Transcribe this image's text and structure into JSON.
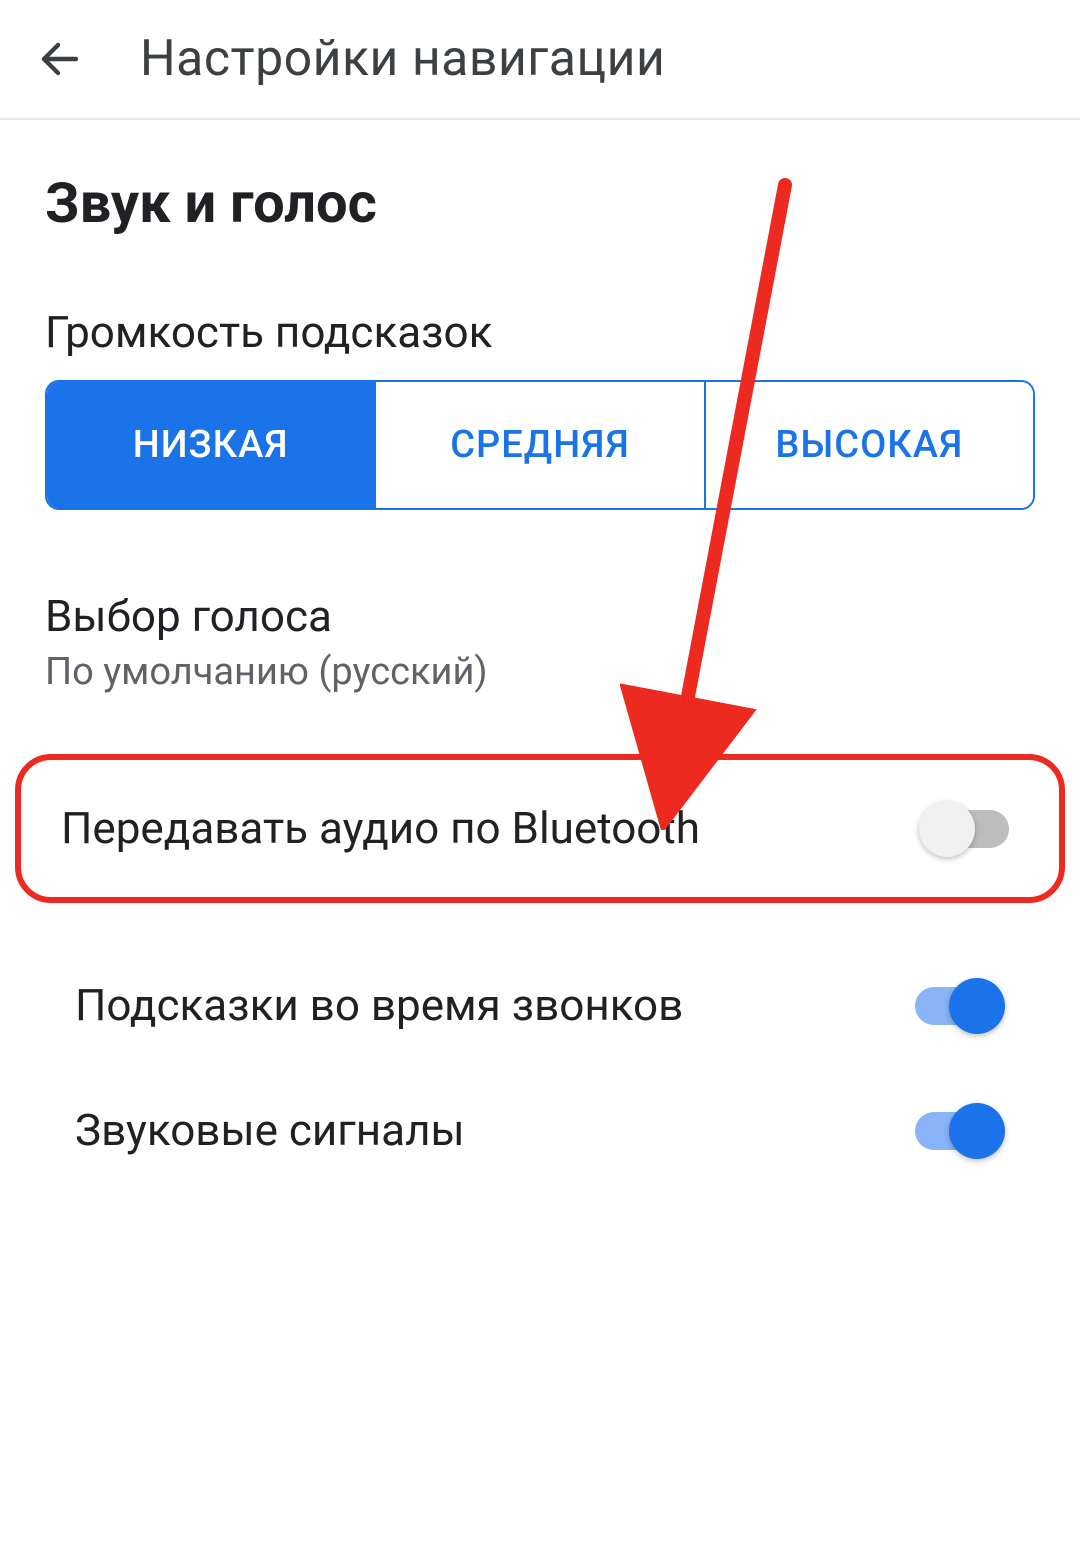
{
  "header": {
    "title": "Настройки навигации"
  },
  "section": {
    "title": "Звук и голос"
  },
  "volume": {
    "label": "Громкость подсказок",
    "options": {
      "low": "НИЗКАЯ",
      "medium": "СРЕДНЯЯ",
      "high": "ВЫСОКАЯ"
    },
    "selected": "low"
  },
  "voice": {
    "title": "Выбор голоса",
    "value": "По умолчанию (русский)"
  },
  "toggles": {
    "bluetooth": {
      "label": "Передавать аудио по Bluetooth",
      "on": false
    },
    "calls": {
      "label": "Подсказки во время звонков",
      "on": true
    },
    "sounds": {
      "label": "Звуковые сигналы",
      "on": true
    }
  },
  "colors": {
    "accent": "#1a73e8",
    "highlight": "#ec2a1f"
  }
}
